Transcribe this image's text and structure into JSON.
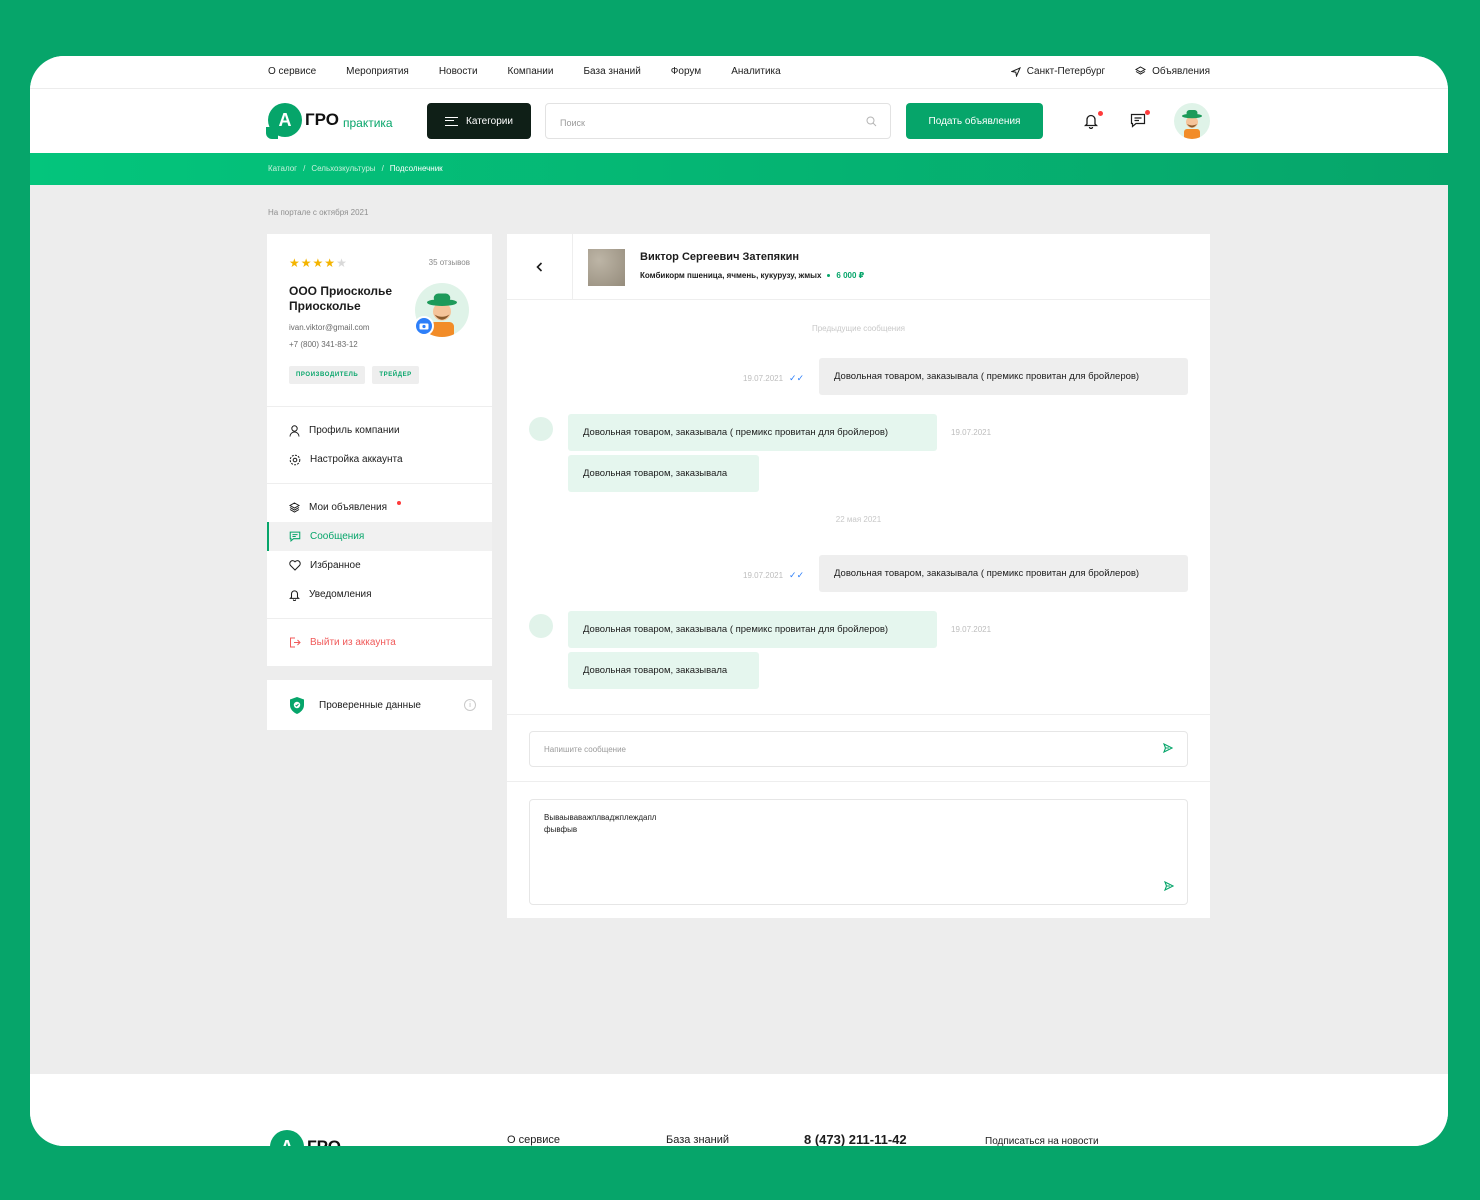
{
  "topnav": {
    "links": [
      "О сервисе",
      "Мероприятия",
      "Новости",
      "Компании",
      "База знаний",
      "Форум",
      "Аналитика"
    ],
    "city": "Санкт-Петербург",
    "ads": "Объявления"
  },
  "header": {
    "logo_letter": "А",
    "logo_main": "ГРО",
    "logo_sub": "практика",
    "categories_label": "Категории",
    "search_placeholder": "Поиск",
    "post_button": "Подать объявления"
  },
  "breadcrumb": [
    "Каталог",
    "/",
    "Сельхозкультуры",
    "/",
    "Подсолнечник"
  ],
  "since": "На портале с октября 2021",
  "profile": {
    "rating": 4,
    "reviews": "35 отзывов",
    "company": "ООО Приосколье Приосколье",
    "email": "ivan.viktor@gmail.com",
    "phone": "+7 (800) 341-83-12",
    "tags": [
      "ПРОИЗВОДИТЕЛЬ",
      "ТРЕЙДЕР"
    ]
  },
  "menu": {
    "profile": "Профиль компании",
    "settings": "Настройка аккаунта",
    "my_ads": "Мои объявления",
    "messages": "Сообщения",
    "favorites": "Избранное",
    "notifications": "Уведомления",
    "logout": "Выйти из аккаунта",
    "verified": "Проверенные данные"
  },
  "chat": {
    "name": "Виктор Сергеевич Затепякин",
    "product": "Комбикорм пшеница, ячмень, кукурузу, жмых",
    "price": "6 000 ₽",
    "prev_messages": "Предыдущие сообщения",
    "date_sep": "22 мая 2021",
    "msg_long": "Довольная товаром, заказывала ( премикс провитан для бройлеров)",
    "msg_short": "Довольная товаром, заказывала",
    "time": "19.07.2021",
    "input_placeholder": "Напишите сообщение",
    "draft_line1": "Вываываважплваджплеждапл",
    "draft_line2": "фывфыв"
  },
  "footer": {
    "link1": "О сервисе",
    "link2": "База знаний",
    "phone": "8 (473) 211-11-42",
    "subscribe": "Подписаться на новости"
  }
}
